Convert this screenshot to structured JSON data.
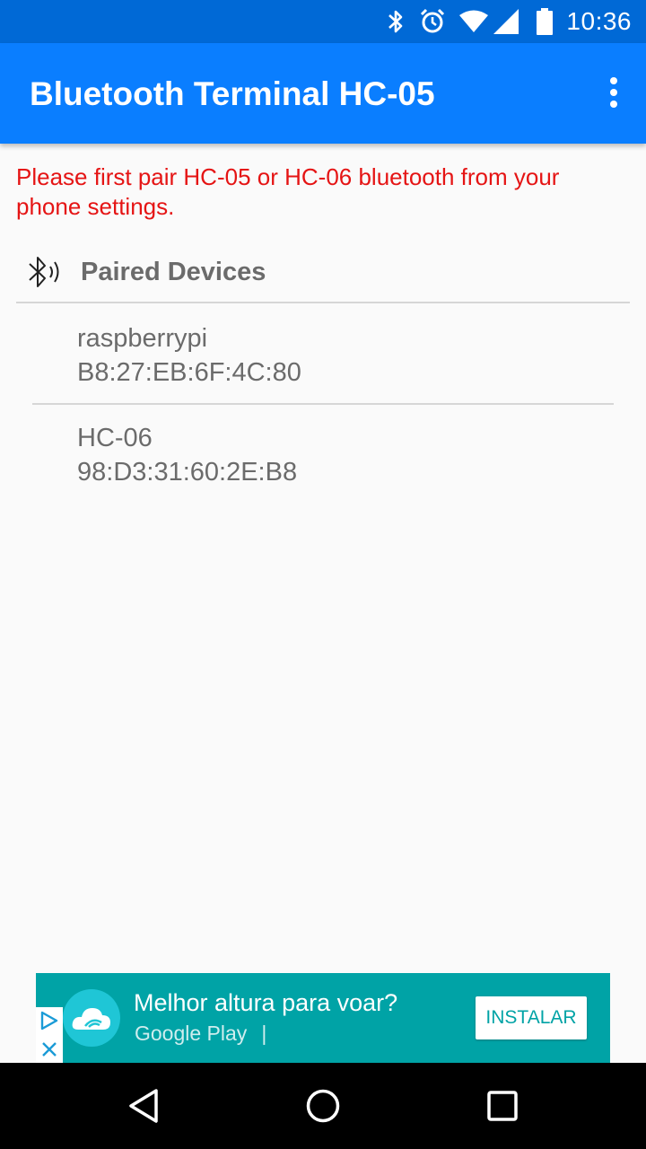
{
  "status_bar": {
    "time": "10:36",
    "icons": [
      "bluetooth-icon",
      "alarm-icon",
      "wifi-icon",
      "cell-signal-icon",
      "battery-icon"
    ]
  },
  "app_bar": {
    "title": "Bluetooth Terminal HC-05",
    "background": "#0a7eff",
    "menu_icon": "overflow-menu-icon"
  },
  "main": {
    "warning": "Please first pair HC-05 or HC-06 bluetooth from your phone settings.",
    "warning_color": "#e51414",
    "section_title": "Paired Devices",
    "section_icon": "bluetooth-searching-icon",
    "devices": [
      {
        "name": "raspberrypi",
        "address": "B8:27:EB:6F:4C:80"
      },
      {
        "name": "HC-06",
        "address": "98:D3:31:60:2E:B8"
      }
    ]
  },
  "ad": {
    "headline": "Melhor altura para voar?",
    "store": "Google Play",
    "separator": "|",
    "install_label": "INSTALAR",
    "background": "#00a3a6"
  },
  "nav_bar": {
    "icons": [
      "back-icon",
      "home-icon",
      "recents-icon"
    ]
  }
}
